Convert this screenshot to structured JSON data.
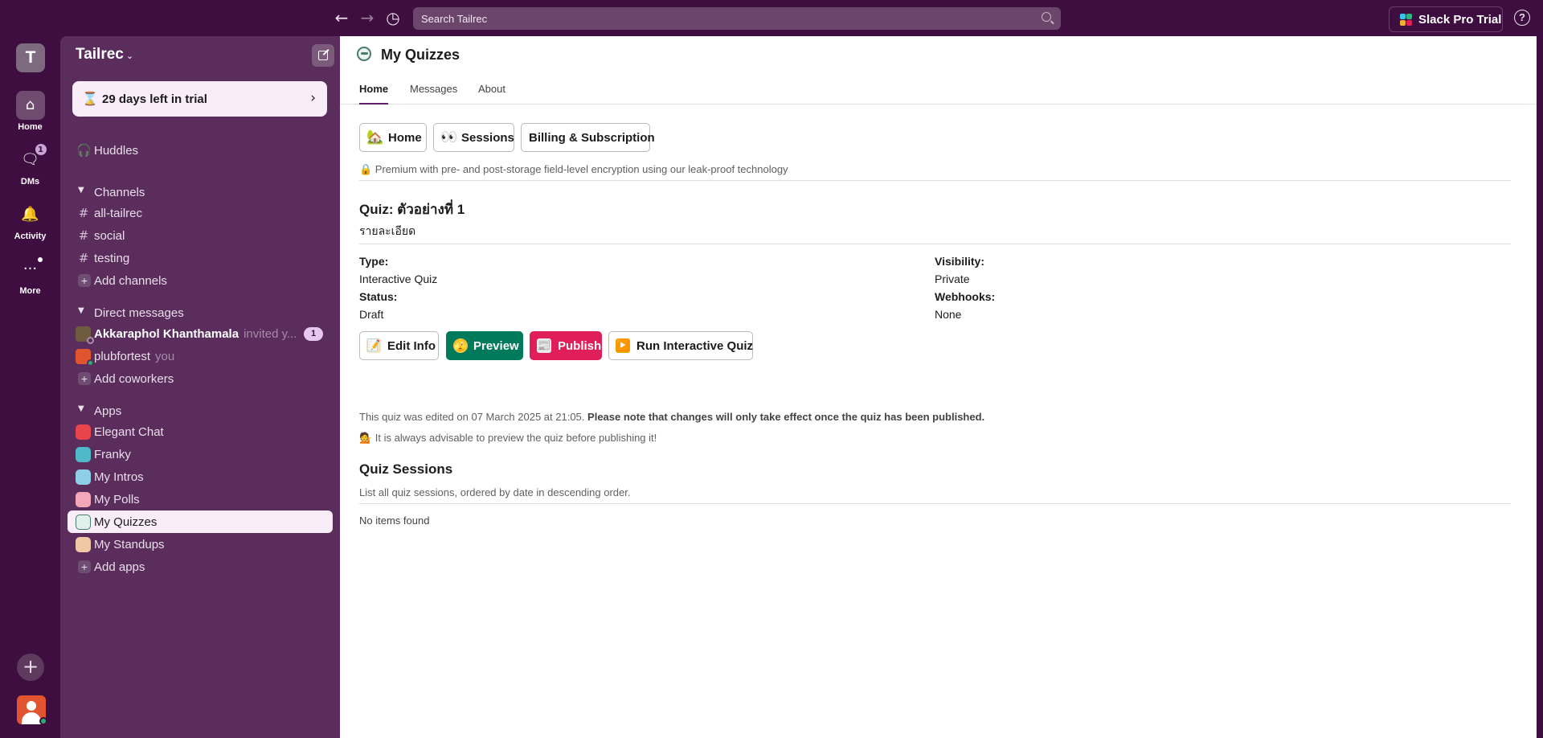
{
  "topbar": {
    "search_placeholder": "Search Tailrec",
    "pro_trial_label": "Slack Pro Trial",
    "help_glyph": "?",
    "icons": [
      "back-arrow-icon",
      "forward-arrow-icon",
      "history-icon",
      "search-icon",
      "slack-logo-icon",
      "help-icon"
    ]
  },
  "rail": {
    "workspace_initial": "T",
    "items": [
      {
        "label": "Home",
        "icon": "home-icon"
      },
      {
        "label": "DMs",
        "icon": "dms-icon",
        "badge": "1"
      },
      {
        "label": "Activity",
        "icon": "bell-icon"
      },
      {
        "label": "More",
        "icon": "more-icon"
      }
    ]
  },
  "sidebar": {
    "workspace_name": "Tailrec",
    "trial_text": "29 days left in trial",
    "huddles": "Huddles",
    "channels_header": "Channels",
    "channels": [
      "all-tailrec",
      "social",
      "testing"
    ],
    "add_channels": "Add channels",
    "dm_header": "Direct messages",
    "dms": [
      {
        "name": "Akkaraphol Khanthamala",
        "sub": "invited y...",
        "badge": "1"
      },
      {
        "name": "plubfortest",
        "sub": "you"
      }
    ],
    "add_coworkers": "Add coworkers",
    "apps_header": "Apps",
    "apps": [
      "Elegant Chat",
      "Franky",
      "My Intros",
      "My Polls",
      "My Quizzes",
      "My Standups"
    ],
    "add_apps": "Add apps",
    "selected_app": "My Quizzes"
  },
  "main": {
    "title": "My Quizzes",
    "tabs": [
      "Home",
      "Messages",
      "About"
    ],
    "active_tab": "Home",
    "top_buttons": [
      {
        "emoji": "🏡",
        "label": "Home"
      },
      {
        "emoji": "👀",
        "label": "Sessions"
      },
      {
        "label": "Billing & Subscription"
      }
    ],
    "premium_note": "🔒 Premium with pre- and post-storage field-level encryption using our leak-proof technology",
    "quiz_title": "Quiz: ตัวอย่างที่ 1",
    "quiz_description": "รายละเอียด",
    "fields": {
      "type_label": "Type:",
      "type_value": "Interactive Quiz",
      "status_label": "Status:",
      "status_value": "Draft",
      "visibility_label": "Visibility:",
      "visibility_value": "Private",
      "webhooks_label": "Webhooks:",
      "webhooks_value": "None"
    },
    "action_buttons": [
      {
        "emoji": "📝",
        "label": "Edit Info"
      },
      {
        "emoji": "🫣",
        "label": "Preview"
      },
      {
        "emoji": "📰",
        "label": "Publish"
      },
      {
        "emoji": "▶️",
        "label": "Run Interactive Quiz"
      }
    ],
    "edited_note": "This quiz was edited on 07 March 2025 at 21:05.",
    "edited_note_bold": "Please note that changes will only take effect once the quiz has been published.",
    "advice": "💁 It is always advisable to preview the quiz before publishing it!",
    "sessions_title": "Quiz Sessions",
    "sessions_desc": "List all quiz sessions, ordered by date in descending order.",
    "empty_text": "No items found"
  },
  "colors": {
    "aubergine": "#3f0e40",
    "sidebar": "#5a2d5c",
    "preview_green": "#007a5a",
    "publish_red": "#e01e5a"
  }
}
